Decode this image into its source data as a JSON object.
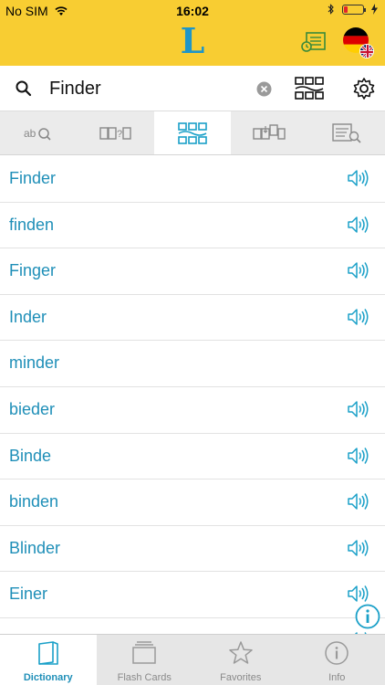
{
  "status_bar": {
    "carrier": "No SIM",
    "time": "16:02",
    "battery_level": 0.2
  },
  "app_bar": {
    "logo": "L"
  },
  "search": {
    "value": "Finder"
  },
  "mode_tabs": [
    {
      "icon": "ab-search-icon",
      "active": false
    },
    {
      "icon": "blank-letters-icon",
      "active": false
    },
    {
      "icon": "anagram-icon",
      "active": true
    },
    {
      "icon": "word-swap-icon",
      "active": false
    },
    {
      "icon": "text-search-icon",
      "active": false
    }
  ],
  "words": [
    {
      "text": "Finder",
      "has_audio": true
    },
    {
      "text": "finden",
      "has_audio": true
    },
    {
      "text": "Finger",
      "has_audio": true
    },
    {
      "text": "Inder",
      "has_audio": true
    },
    {
      "text": "minder",
      "has_audio": false
    },
    {
      "text": "bieder",
      "has_audio": true
    },
    {
      "text": "Binde",
      "has_audio": true
    },
    {
      "text": "binden",
      "has_audio": true
    },
    {
      "text": "Blinder",
      "has_audio": true
    },
    {
      "text": "Einer",
      "has_audio": true
    },
    {
      "text": "",
      "has_audio": true
    }
  ],
  "tab_bar": {
    "tabs": [
      {
        "label": "Dictionary",
        "icon": "book-icon",
        "active": true
      },
      {
        "label": "Flash Cards",
        "icon": "flash-cards-icon",
        "active": false
      },
      {
        "label": "Favorites",
        "icon": "star-icon",
        "active": false
      },
      {
        "label": "Info",
        "icon": "info-icon",
        "active": false
      }
    ]
  },
  "colors": {
    "header_yellow": "#f8cd32",
    "accent_blue": "#1f8fb8",
    "logo_blue": "#1f96c8",
    "icon_teal": "#1aa0c8",
    "battery_red": "#e3242b"
  }
}
